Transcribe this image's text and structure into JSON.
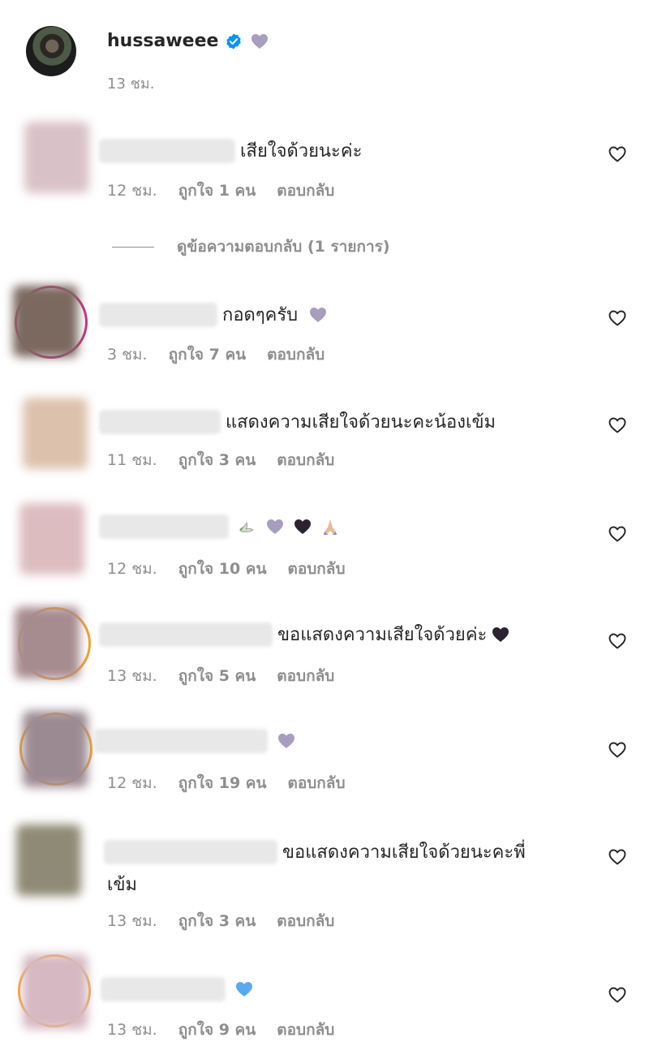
{
  "post": {
    "username": "hussaweee",
    "time": "13 ชม."
  },
  "view_replies_label": "ดูข้อความตอบกลับ (1 รายการ)",
  "reply_label": "ตอบกลับ",
  "comments": [
    {
      "text": "เสียใจด้วยนะค่ะ",
      "time": "12 ชม.",
      "likes": "ถูกใจ 1 คน"
    },
    {
      "text": "กอดๆครับ",
      "time": "3 ชม.",
      "likes": "ถูกใจ 7 คน"
    },
    {
      "text": "แสดงความเสียใจด้วยนะคะน้องเข้ม",
      "time": "11 ชม.",
      "likes": "ถูกใจ 3 คน"
    },
    {
      "text": "",
      "time": "12 ชม.",
      "likes": "ถูกใจ 10 คน"
    },
    {
      "text": "ขอแสดงความเสียใจด้วยค่ะ",
      "time": "13 ชม.",
      "likes": "ถูกใจ 5 คน"
    },
    {
      "text": "",
      "time": "12 ชม.",
      "likes": "ถูกใจ 19 คน"
    },
    {
      "text": "ขอแสดงความเสียใจด้วยนะคะพี่",
      "text2": "เข้ม",
      "time": "13 ชม.",
      "likes": "ถูกใจ 3 คน"
    },
    {
      "text": "",
      "time": "13 ชม.",
      "likes": "ถูกใจ 9 คน"
    }
  ],
  "icons": {
    "verified": "verified-badge-icon",
    "like": "heart-outline-icon",
    "emoji_grey_heart": "grey-heart-emoji",
    "emoji_black_heart": "black-heart-emoji",
    "emoji_blue_heart": "blue-heart-emoji",
    "emoji_dove": "dove-emoji",
    "emoji_pray": "folded-hands-emoji"
  },
  "colors": {
    "text": "#262626",
    "secondary": "#8e8e8e",
    "verified": "#0095f6",
    "grey_heart": "#a79dbf",
    "black_heart": "#2b2330",
    "blue_heart": "#5aa9f0"
  }
}
